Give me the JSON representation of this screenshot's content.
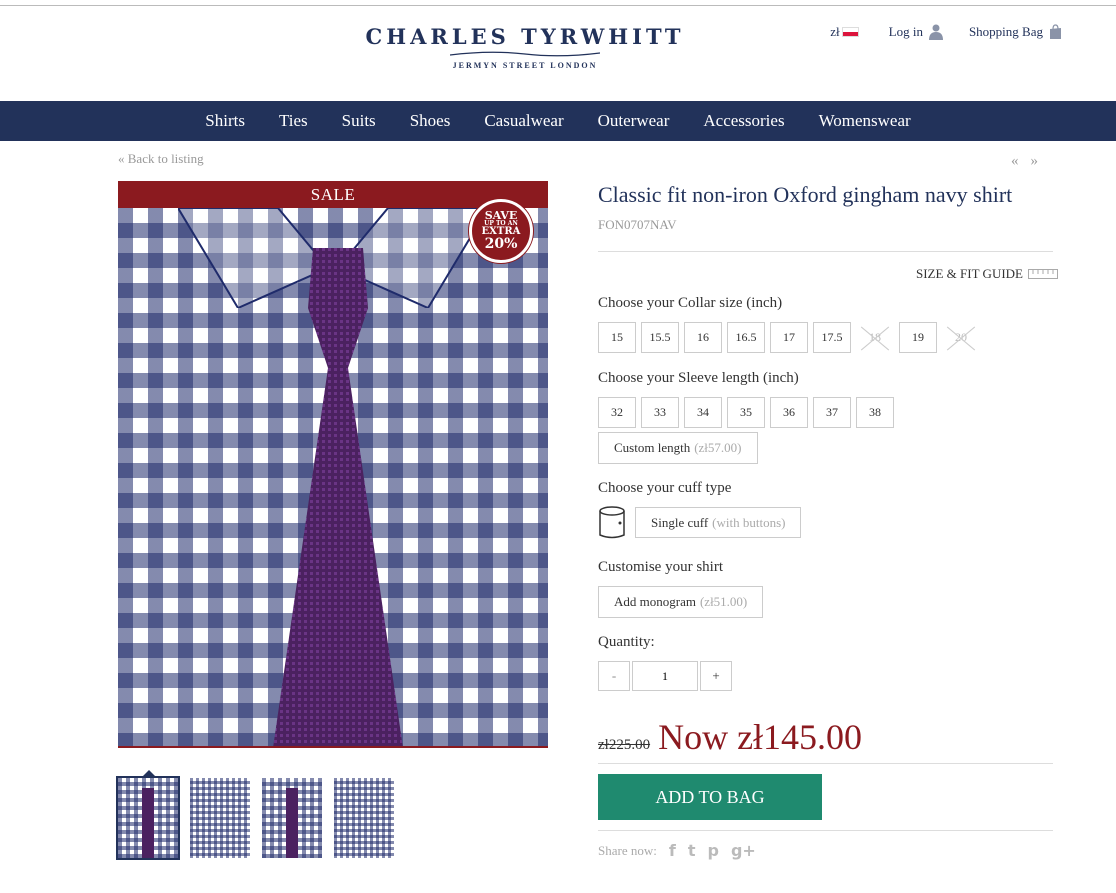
{
  "header": {
    "brand": "CHARLES TYRWHITT",
    "tagline": "JERMYN STREET LONDON",
    "currency": "zł",
    "login_label": "Log in",
    "bag_label": "Shopping Bag"
  },
  "nav": {
    "items": [
      "Shirts",
      "Ties",
      "Suits",
      "Shoes",
      "Casualwear",
      "Outerwear",
      "Accessories",
      "Womenswear"
    ]
  },
  "breadcrumb": {
    "back_label": "Back to listing",
    "prev_label": "«",
    "next_label": "»"
  },
  "gallery": {
    "sale_label": "SALE",
    "badge": {
      "line1": "SAVE",
      "line2": "UP TO AN",
      "line3": "EXTRA",
      "line4": "20%"
    },
    "thumbnail_count": 4,
    "selected_thumbnail": 1
  },
  "product": {
    "title": "Classic fit non-iron Oxford gingham navy shirt",
    "code": "FON0707NAV",
    "size_guide_label": "SIZE & FIT GUIDE",
    "collar_label": "Choose your Collar size (inch)",
    "collar_sizes": [
      {
        "v": "15",
        "available": true
      },
      {
        "v": "15.5",
        "available": true
      },
      {
        "v": "16",
        "available": true
      },
      {
        "v": "16.5",
        "available": true
      },
      {
        "v": "17",
        "available": true
      },
      {
        "v": "17.5",
        "available": true
      },
      {
        "v": "18",
        "available": false
      },
      {
        "v": "19",
        "available": true
      },
      {
        "v": "20",
        "available": false
      }
    ],
    "sleeve_label": "Choose your Sleeve length (inch)",
    "sleeve_lengths": [
      "32",
      "33",
      "34",
      "35",
      "36",
      "37",
      "38"
    ],
    "custom_length_label": "Custom length",
    "custom_length_price": "(zł57.00)",
    "cuff_label": "Choose your cuff type",
    "cuff_option": "Single cuff",
    "cuff_option_note": "(with buttons)",
    "customise_label": "Customise your shirt",
    "monogram_label": "Add monogram",
    "monogram_price": "(zł51.00)",
    "quantity_label": "Quantity:",
    "quantity_value": "1",
    "qty_minus": "-",
    "qty_plus": "+",
    "old_price": "zł225.00",
    "now_price": "Now zł145.00",
    "add_to_bag": "ADD TO BAG",
    "share_label": "Share now:",
    "share_icons": [
      "f",
      "t",
      "p",
      "g+"
    ]
  },
  "colors": {
    "navy": "#22325a",
    "sale_red": "#8b1a1f",
    "cta_green": "#1f8a6f",
    "tie_purple": "#4b2160"
  }
}
